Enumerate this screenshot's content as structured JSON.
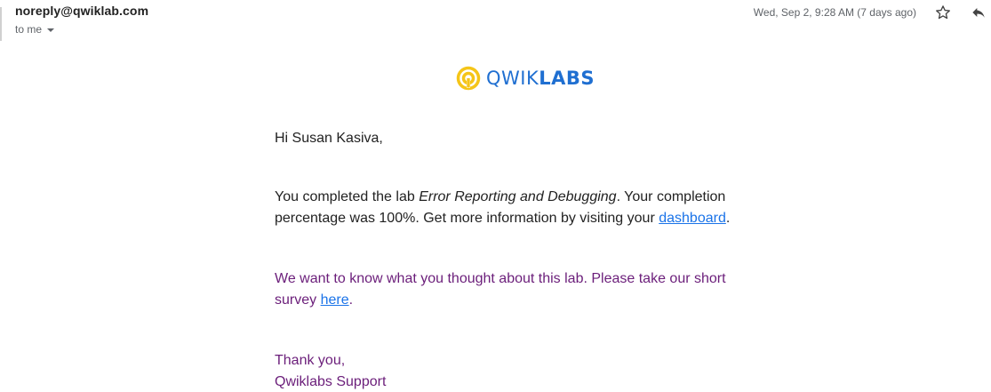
{
  "header": {
    "sender": "noreply@qwiklab.com",
    "recipient_label": "to me",
    "date": "Wed, Sep 2, 9:28 AM (7 days ago)",
    "icons": {
      "star": "star-icon",
      "reply": "reply-icon",
      "dropdown": "chevron-down-icon"
    }
  },
  "logo": {
    "brand_light": "QWIK",
    "brand_bold": "LABS",
    "colors": {
      "mark": "#f5c518",
      "text": "#1f6fd1"
    }
  },
  "message": {
    "greeting": "Hi Susan Kasiva,",
    "p1_prefix": "You completed the lab ",
    "p1_lab_name": "Error Reporting and Debugging",
    "p1_middle": ". Your completion percentage was 100%. Get more information by visiting your ",
    "p1_link": "dashboard",
    "p1_suffix": ".",
    "p2_prefix": "We want to know what you thought about this lab. Please take our short survey ",
    "p2_link": "here",
    "p2_suffix": ".",
    "signoff": "Thank you,",
    "signature": "Qwiklabs Support"
  },
  "colors": {
    "text": "#222222",
    "muted": "#5f6368",
    "link": "#1a73e8",
    "purple": "#6b1e7a"
  }
}
